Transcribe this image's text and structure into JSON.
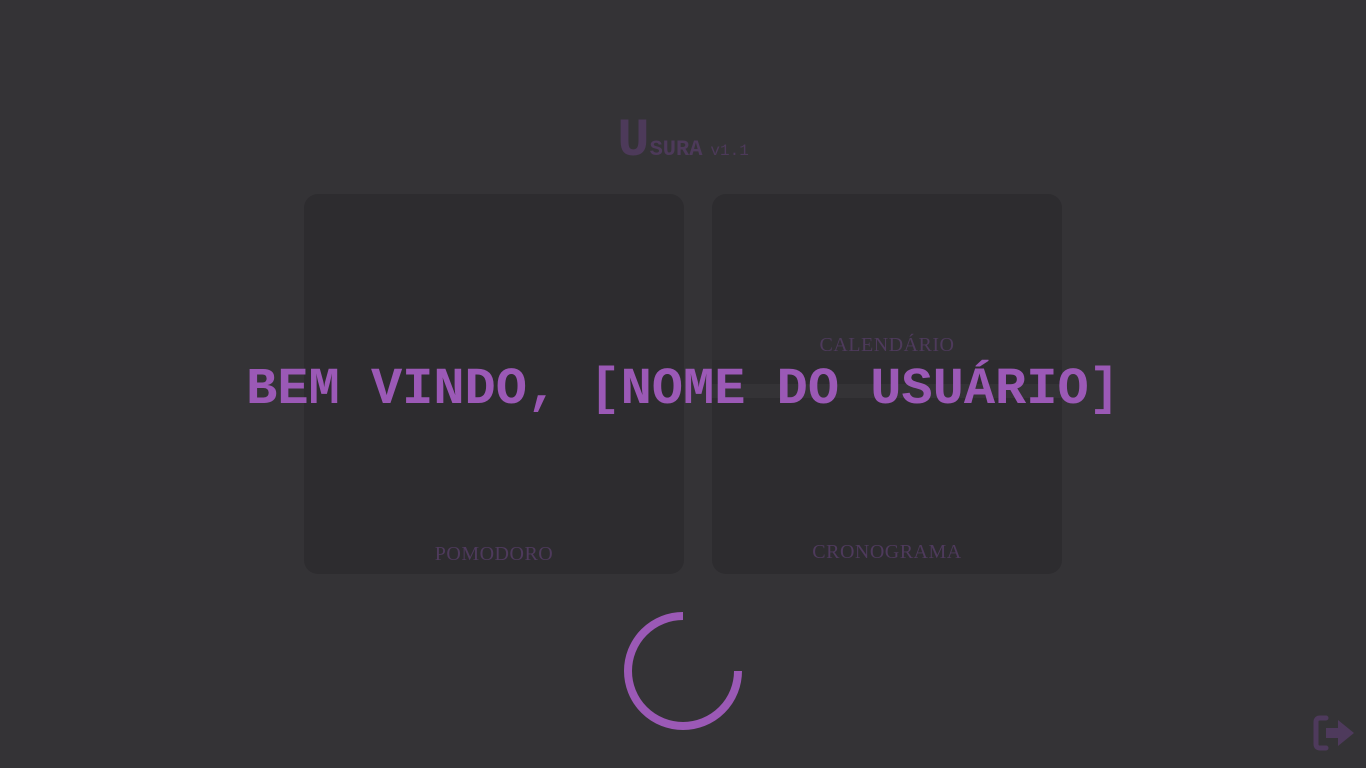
{
  "app": {
    "logo_big": "U",
    "logo_small": "SURA",
    "version": "v1.1"
  },
  "cards": {
    "pomodoro": "POMODORO",
    "calendario": "CALENDÁRIO",
    "cronograma": "CRONOGRAMA"
  },
  "overlay": {
    "welcome": "BEM VINDO, [NOME DO USUÁRIO]",
    "spinner_icon": "loading-spinner-icon",
    "logout_icon": "sign-out-icon"
  },
  "colors": {
    "background": "#343336",
    "card": "#2d2c2f",
    "accent": "#9b59b6",
    "dim_accent": "#4e3a5c"
  }
}
